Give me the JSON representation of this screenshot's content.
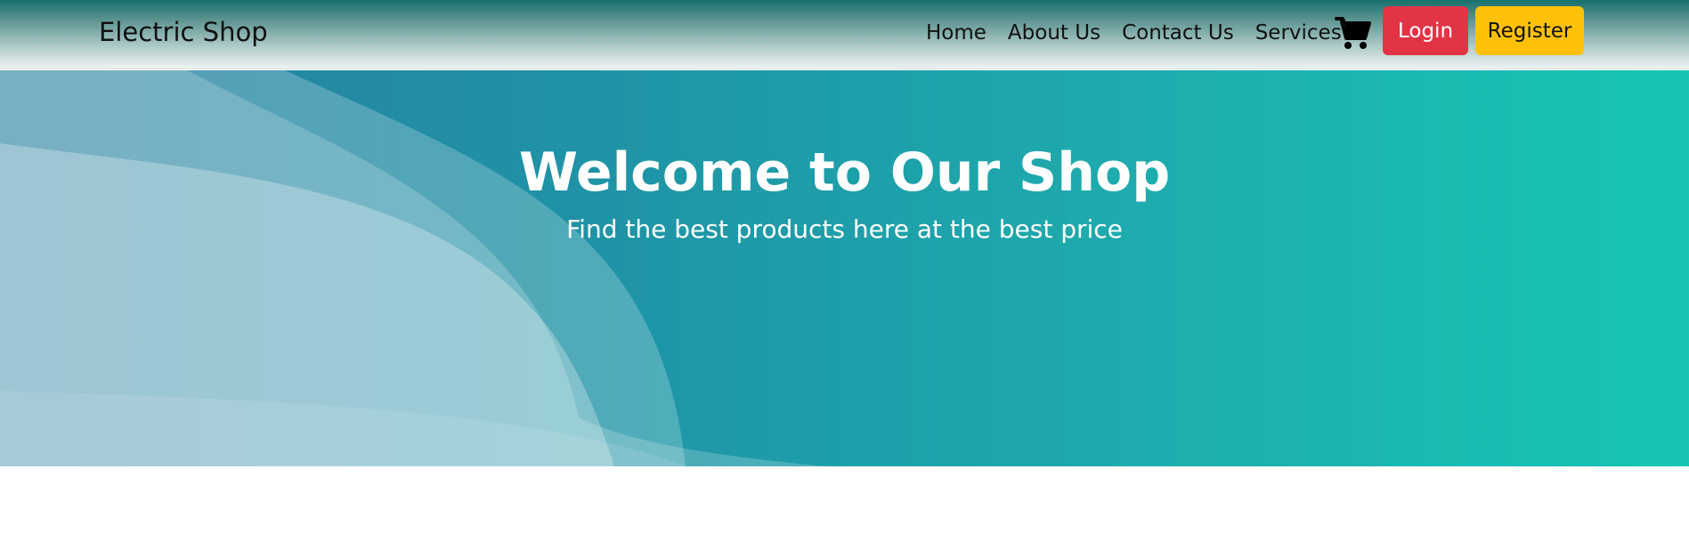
{
  "navbar": {
    "brand": "Electric Shop",
    "links": [
      "Home",
      "About Us",
      "Contact Us",
      "Services"
    ],
    "cart_icon": "shopping-cart-icon",
    "login_label": "Login",
    "register_label": "Register"
  },
  "hero": {
    "title": "Welcome to Our Shop",
    "subtitle": "Find the best products here at the best price"
  },
  "colors": {
    "login_button": "#e23445",
    "register_button": "#ffc107",
    "hero_gradient_start": "#2a7fa0",
    "hero_gradient_end": "#17c5b4"
  }
}
